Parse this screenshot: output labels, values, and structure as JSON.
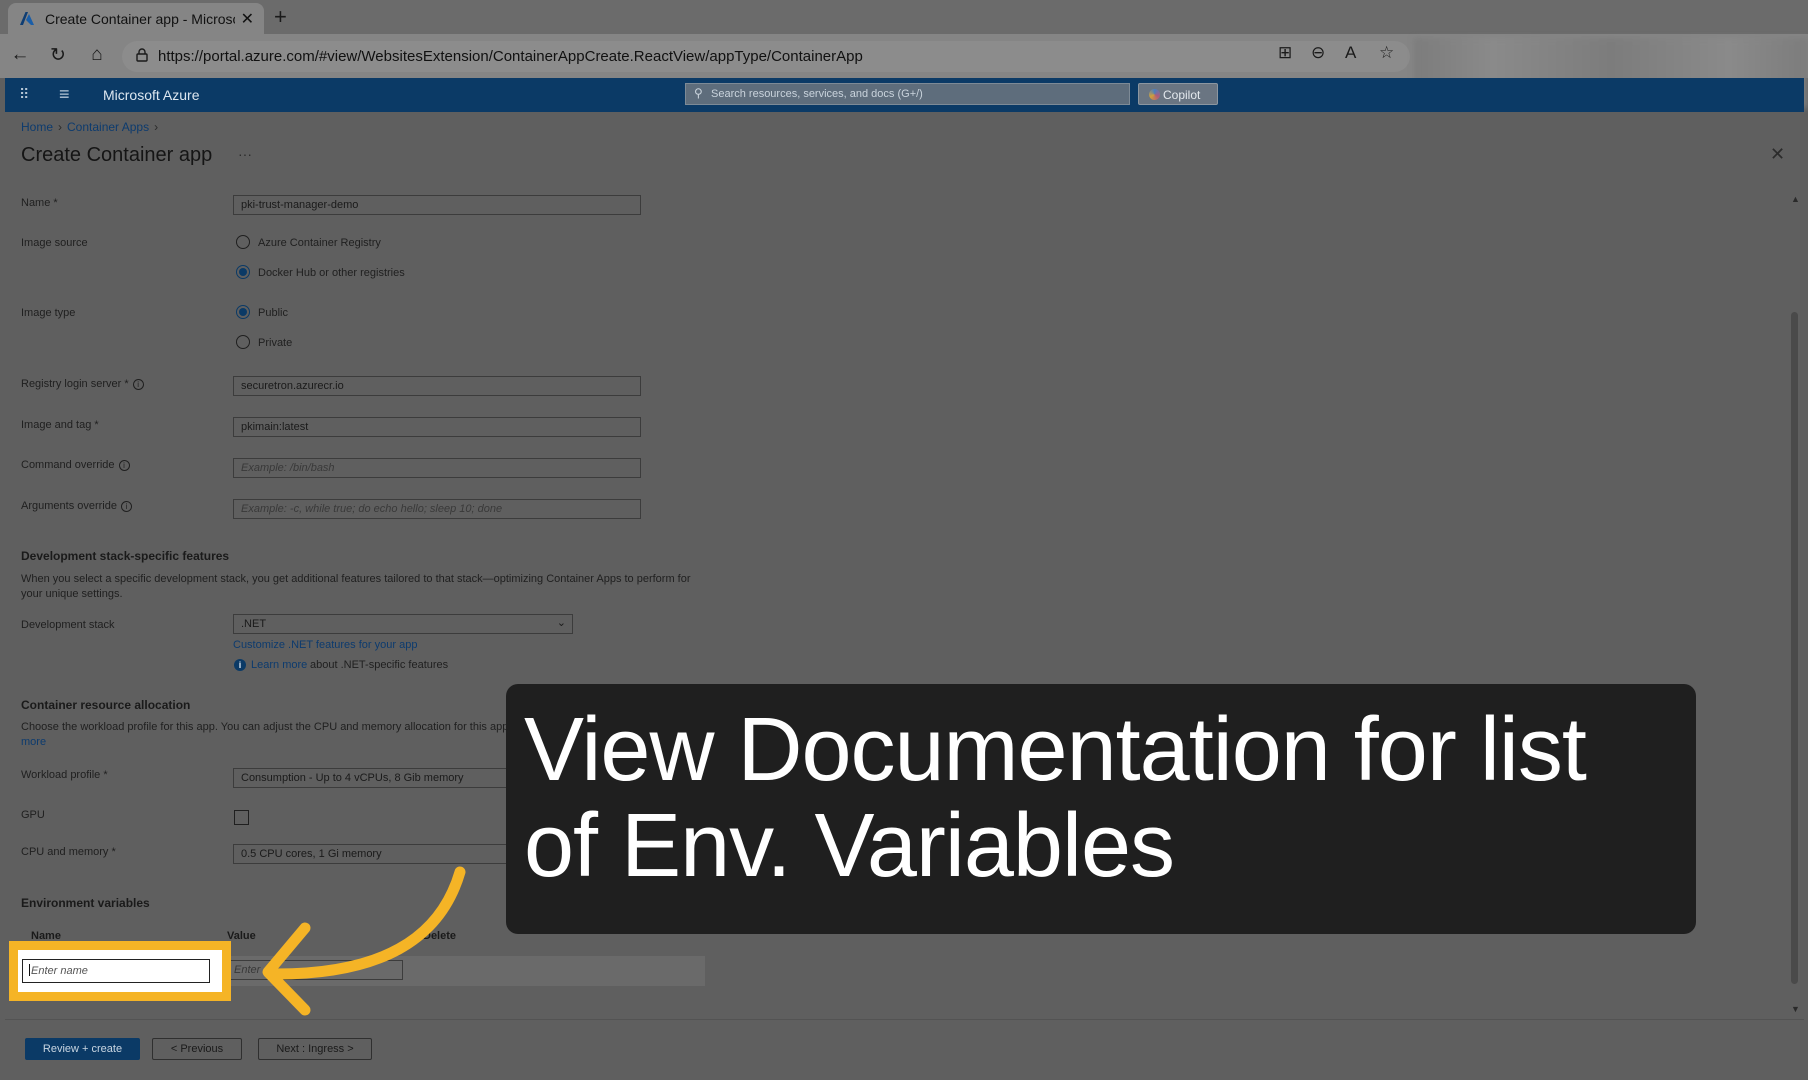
{
  "browser": {
    "tab_title": "Create Container app - Microsoft",
    "url": "https://portal.azure.com/#view/WebsitesExtension/ContainerAppCreate.ReactView/appType/ContainerApp",
    "icons": [
      "azure-logo-icon",
      "close-icon",
      "plus-icon",
      "back-icon",
      "refresh-icon",
      "home-icon",
      "lock-icon",
      "apps-icon",
      "zoom-icon",
      "read-aloud-icon",
      "favorite-icon"
    ]
  },
  "portal": {
    "brand": "Microsoft Azure",
    "search_placeholder": "Search resources, services, and docs (G+/)",
    "copilot_label": "Copilot"
  },
  "breadcrumb": {
    "home": "Home",
    "container_apps": "Container Apps"
  },
  "page_title": "Create Container app",
  "form": {
    "name_label": "Name *",
    "name_value": "pki-trust-manager-demo",
    "image_source_label": "Image source",
    "image_source_options": [
      "Azure Container Registry",
      "Docker Hub or other registries"
    ],
    "image_source_selected": "Docker Hub or other registries",
    "image_type_label": "Image type",
    "image_type_options": [
      "Public",
      "Private"
    ],
    "image_type_selected": "Public",
    "registry_label": "Registry login server *",
    "registry_value": "securetron.azurecr.io",
    "image_tag_label": "Image and tag *",
    "image_tag_value": "pkimain:latest",
    "command_label": "Command override",
    "command_placeholder": "Example: /bin/bash",
    "args_label": "Arguments override",
    "args_placeholder": "Example: -c, while true; do echo hello; sleep 10; done"
  },
  "dev_stack": {
    "heading": "Development stack-specific features",
    "description": "When you select a specific development stack, you get additional features tailored to that stack—optimizing Container Apps to perform for your unique settings.",
    "label": "Development stack",
    "value": ".NET",
    "customize_link": "Customize .NET features for your app",
    "learn_more": "Learn more",
    "learn_more_suffix": "about .NET-specific features"
  },
  "resources": {
    "heading": "Container resource allocation",
    "description": "Choose the workload profile for this app. You can adjust the CPU and memory allocation for this app",
    "more_link": "more",
    "workload_label": "Workload profile *",
    "workload_value": "Consumption - Up to 4 vCPUs, 8 Gib memory",
    "gpu_label": "GPU",
    "gpu_checked": false,
    "cpu_label": "CPU and memory *",
    "cpu_value": "0.5 CPU cores, 1 Gi memory"
  },
  "env": {
    "heading": "Environment variables",
    "col_name": "Name",
    "col_value": "Value",
    "col_delete": "Delete",
    "name_placeholder": "Enter name",
    "value_placeholder": "Enter"
  },
  "footer": {
    "review_create": "Review + create",
    "previous": "< Previous",
    "next": "Next : Ingress >"
  },
  "callout": {
    "text": "View Documentation for list of Env. Variables"
  },
  "colors": {
    "highlight": "#f5b426",
    "callout_bg": "#1f1f1f",
    "azure_header": "#0b3a66"
  }
}
